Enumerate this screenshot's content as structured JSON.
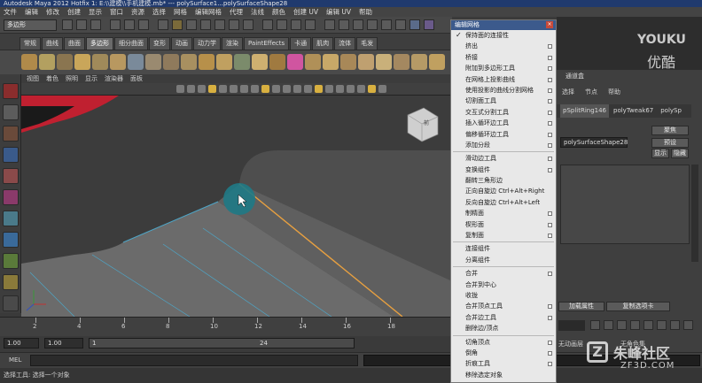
{
  "window": {
    "title": "Autodesk Maya 2012 Hotfix 1: E:\\\\建模\\\\手机建模.mb* --- polySurface1...polySurfaceShape28"
  },
  "menubar": [
    "文件",
    "编辑",
    "修改",
    "创建",
    "显示",
    "窗口",
    "资源",
    "选择",
    "网格",
    "编辑网格",
    "代理",
    "法线",
    "颜色",
    "创建 UV",
    "编辑 UV",
    "帮助"
  ],
  "statusline": {
    "mode": "多边形"
  },
  "shelf": {
    "tabs": [
      "常规",
      "曲线",
      "曲面",
      "多边形",
      "细分曲面",
      "变形",
      "动画",
      "动力学",
      "渲染",
      "PaintEffects",
      "卡通",
      "肌肉",
      "流体",
      "毛发"
    ],
    "active": "多边形",
    "icon_colors": [
      "#b08a4a",
      "#b3a060",
      "#8a7550",
      "#c9a65a",
      "#a08a5a",
      "#b89860",
      "#7a8a9a",
      "#9a8a70",
      "#8f7a5c",
      "#a89060",
      "#b7904a",
      "#c0a060",
      "#7b8b6b",
      "#cfb070",
      "#a07a40",
      "#d055a0",
      "#b09058",
      "#c8a868",
      "#a88858",
      "#bfa070",
      "#c9b07a",
      "#a48860",
      "#b59a66",
      "#c0a060"
    ]
  },
  "viewport": {
    "menu": [
      "视图",
      "着色",
      "照明",
      "显示",
      "渲染器",
      "面板"
    ],
    "viewcube_label": "前"
  },
  "timeline": {
    "ticks": [
      "2",
      "4",
      "6",
      "8",
      "10",
      "12",
      "14",
      "16",
      "18"
    ],
    "range": {
      "start": "1.00",
      "start2": "1.00",
      "marker": "1",
      "end_marker": "24"
    }
  },
  "mel": {
    "label": "MEL"
  },
  "helpline": {
    "text": "选择工具: 选择一个对象"
  },
  "right_panel": {
    "menu": [
      "选择",
      "节点",
      "帮助"
    ],
    "title_label": "通道盒",
    "tabs": [
      "pSplitRing146",
      "polyTweak67",
      "polySp"
    ],
    "shape_field": "polySurfaceShape28",
    "focus_button": "聚焦",
    "preset_button": "预设",
    "show_button": "显示",
    "hide_button": "隐藏",
    "load_attr_button": "加载属性",
    "copy_tab_button": "复制选项卡",
    "anim_layer_label": "无动画层",
    "char_set_label": "无角色集"
  },
  "context_menu": {
    "title": "编辑网格",
    "groups": [
      [
        {
          "label": "保持面的连接性",
          "checked": true,
          "option": false
        },
        {
          "label": "挤出",
          "option": true
        },
        {
          "label": "桥接",
          "option": true
        },
        {
          "label": "附加到多边形工具",
          "option": true
        },
        {
          "label": "在网格上投影曲线",
          "option": true
        },
        {
          "label": "使用投影的曲线分割网格",
          "option": true
        },
        {
          "label": "切割面工具",
          "option": true
        },
        {
          "label": "交互式分割工具",
          "option": true
        },
        {
          "label": "插入循环边工具",
          "option": true
        },
        {
          "label": "偏移循环边工具",
          "option": true
        },
        {
          "label": "添加分段",
          "option": true
        }
      ],
      [
        {
          "label": "滑动边工具",
          "option": true
        },
        {
          "label": "变换组件",
          "option": true
        },
        {
          "label": "翻转三角形边",
          "option": false
        },
        {
          "label": "正向自旋边  Ctrl+Alt+Right",
          "option": false
        },
        {
          "label": "反向自旋边  Ctrl+Alt+Left",
          "option": false
        },
        {
          "label": "制精面",
          "option": true
        },
        {
          "label": "楔形面",
          "option": true
        },
        {
          "label": "复制面",
          "option": true
        }
      ],
      [
        {
          "label": "连接组件",
          "option": false
        },
        {
          "label": "分离组件",
          "option": false
        }
      ],
      [
        {
          "label": "合并",
          "option": true
        },
        {
          "label": "合并到中心",
          "option": false
        },
        {
          "label": "收拢",
          "option": false
        },
        {
          "label": "合并顶点工具",
          "option": true
        },
        {
          "label": "合并边工具",
          "option": true
        },
        {
          "label": "删除边/顶点",
          "option": false
        }
      ],
      [
        {
          "label": "切角顶点",
          "option": true
        },
        {
          "label": "倒角",
          "option": true
        },
        {
          "label": "折痕工具",
          "option": true
        },
        {
          "label": "移除选定对象",
          "option": false
        }
      ]
    ]
  },
  "watermarks": {
    "youku_en": "YOUKU",
    "youku_cn": "优酷",
    "site_cn": "朱峰社区",
    "site_en": "ZF3D.COM"
  },
  "colors": {
    "accent_orange": "#e8a040",
    "highlight_cyan": "#5ec8d8",
    "selection_teal": "#1f7a86",
    "menu_header": "#3c5a8c"
  }
}
